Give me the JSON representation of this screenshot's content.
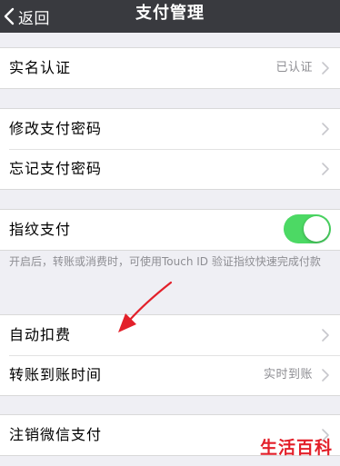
{
  "header": {
    "back_label": "返回",
    "title": "支付管理"
  },
  "group1": {
    "realname": {
      "label": "实名认证",
      "value": "已认证"
    }
  },
  "group2": {
    "change_password": {
      "label": "修改支付密码"
    },
    "forgot_password": {
      "label": "忘记支付密码"
    }
  },
  "group3": {
    "fingerprint": {
      "label": "指纹支付",
      "enabled": true
    },
    "note": "开启后，转账或消费时，可使用Touch ID 验证指纹快速完成付款"
  },
  "group4": {
    "auto_deduct": {
      "label": "自动扣费"
    },
    "transfer_time": {
      "label": "转账到账时间",
      "value": "实时到账"
    }
  },
  "group5": {
    "cancel_wechat_pay": {
      "label": "注销微信支付"
    }
  },
  "watermark": "生活百科",
  "colors": {
    "navbar": "#393a3f",
    "toggle_on": "#4cd964",
    "background": "#efeff4",
    "annotation_arrow": "#e3202a"
  },
  "icons": [
    "chevron-left-icon",
    "chevron-right-icon",
    "toggle-switch",
    "annotation-arrow"
  ]
}
